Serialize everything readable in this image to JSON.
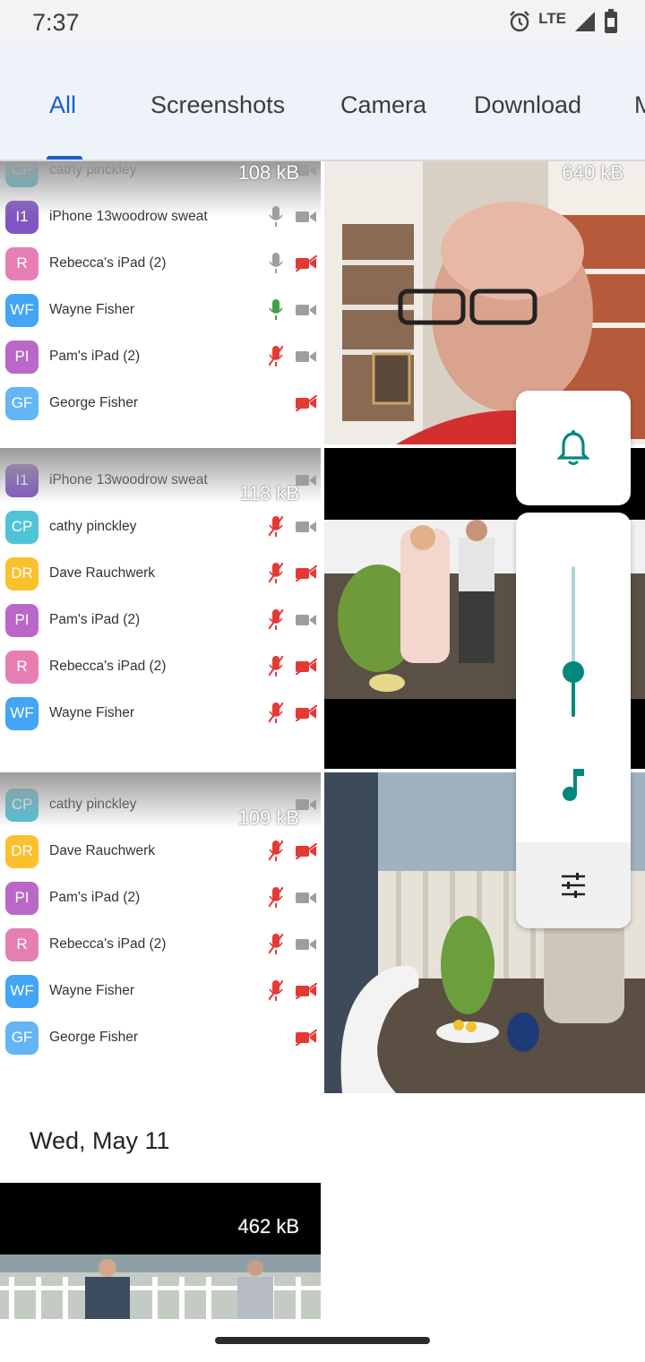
{
  "status": {
    "time": "7:37",
    "network": "LTE"
  },
  "tabs": [
    {
      "label": "All",
      "active": true
    },
    {
      "label": "Screenshots",
      "active": false
    },
    {
      "label": "Camera",
      "active": false
    },
    {
      "label": "Download",
      "active": false
    },
    {
      "label": "M",
      "active": false
    }
  ],
  "tiles": [
    {
      "size": "108 kB",
      "participants": [
        {
          "initials": "CP",
          "name": "cathy pinckley",
          "color": "#4fc3d7",
          "mic": "none",
          "cam": "on"
        },
        {
          "initials": "I1",
          "name": "iPhone 13woodrow sweat",
          "color": "#7e57c2",
          "mic": "on",
          "cam": "on"
        },
        {
          "initials": "R",
          "name": "Rebecca's iPad (2)",
          "color": "#e57fb3",
          "mic": "on",
          "cam": "off"
        },
        {
          "initials": "WF",
          "name": "Wayne Fisher",
          "color": "#42a5f5",
          "mic": "active",
          "cam": "on"
        },
        {
          "initials": "PI",
          "name": "Pam's iPad (2)",
          "color": "#ba68c8",
          "mic": "off",
          "cam": "on"
        },
        {
          "initials": "GF",
          "name": "George Fisher",
          "color": "#64b5f6",
          "mic": "none",
          "cam": "off"
        }
      ]
    },
    {
      "size": "118 kB",
      "participants": [
        {
          "initials": "I1",
          "name": "iPhone 13woodrow sweat",
          "color": "#7e57c2",
          "mic": "none",
          "cam": "on"
        },
        {
          "initials": "CP",
          "name": "cathy pinckley",
          "color": "#4fc3d7",
          "mic": "off",
          "cam": "on"
        },
        {
          "initials": "DR",
          "name": "Dave Rauchwerk",
          "color": "#fbc02d",
          "mic": "off",
          "cam": "off"
        },
        {
          "initials": "PI",
          "name": "Pam's iPad (2)",
          "color": "#ba68c8",
          "mic": "off",
          "cam": "on"
        },
        {
          "initials": "R",
          "name": "Rebecca's iPad (2)",
          "color": "#e57fb3",
          "mic": "off",
          "cam": "off"
        },
        {
          "initials": "WF",
          "name": "Wayne Fisher",
          "color": "#42a5f5",
          "mic": "off",
          "cam": "off"
        }
      ]
    },
    {
      "size": "109 kB",
      "participants": [
        {
          "initials": "CP",
          "name": "cathy pinckley",
          "color": "#4fc3d7",
          "mic": "none",
          "cam": "on"
        },
        {
          "initials": "DR",
          "name": "Dave Rauchwerk",
          "color": "#fbc02d",
          "mic": "off",
          "cam": "off"
        },
        {
          "initials": "PI",
          "name": "Pam's iPad (2)",
          "color": "#ba68c8",
          "mic": "off",
          "cam": "on"
        },
        {
          "initials": "R",
          "name": "Rebecca's iPad (2)",
          "color": "#e57fb3",
          "mic": "off",
          "cam": "on"
        },
        {
          "initials": "WF",
          "name": "Wayne Fisher",
          "color": "#42a5f5",
          "mic": "off",
          "cam": "off"
        },
        {
          "initials": "GF",
          "name": "George Fisher",
          "color": "#64b5f6",
          "mic": "none",
          "cam": "off"
        }
      ]
    }
  ],
  "photo_sizes": {
    "man_video": "640 kB",
    "bottom_video": "462 kB"
  },
  "date_header": "Wed, May 11",
  "volume": {
    "level": 0.3,
    "accent": "#00897b",
    "icons": [
      "bell-icon",
      "music-note-icon",
      "equalizer-settings-icon"
    ]
  }
}
